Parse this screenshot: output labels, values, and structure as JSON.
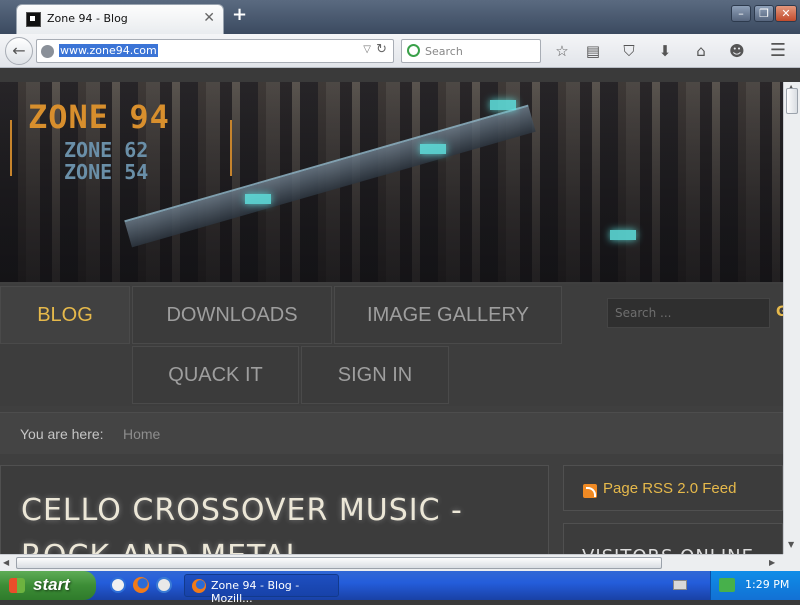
{
  "browser": {
    "tab_title": "Zone 94 - Blog",
    "new_tab_label": "+",
    "url": "www.zone94.com",
    "search_placeholder": "Search",
    "toolbar_icons": [
      "star-icon",
      "reading-list-icon",
      "pocket-icon",
      "download-icon",
      "home-icon",
      "hello-icon",
      "menu-icon"
    ]
  },
  "site": {
    "logo_main": "ZONE 94",
    "logo_sub1": "ZONE 62",
    "logo_sub2": "ZONE 54",
    "menu": [
      {
        "label": "BLOG",
        "active": true
      },
      {
        "label": "DOWNLOADS",
        "active": false
      },
      {
        "label": "IMAGE GALLERY",
        "active": false
      },
      {
        "label": "QUACK IT",
        "active": false
      },
      {
        "label": "SIGN IN",
        "active": false
      }
    ],
    "search_placeholder": "Search ...",
    "breadcrumb_label": "You are here:",
    "breadcrumb_link": "Home",
    "article_title": "CELLO CROSSOVER MUSIC - ROCK AND METAL",
    "rss_label": "Page RSS 2.0 Feed",
    "sidebar_module_title": "VISITORS ONLINE",
    "accent_color": "#e6b94b"
  },
  "taskbar": {
    "start_label": "start",
    "task_label": "Zone 94 - Blog - Mozill...",
    "clock": "1:29 PM"
  }
}
